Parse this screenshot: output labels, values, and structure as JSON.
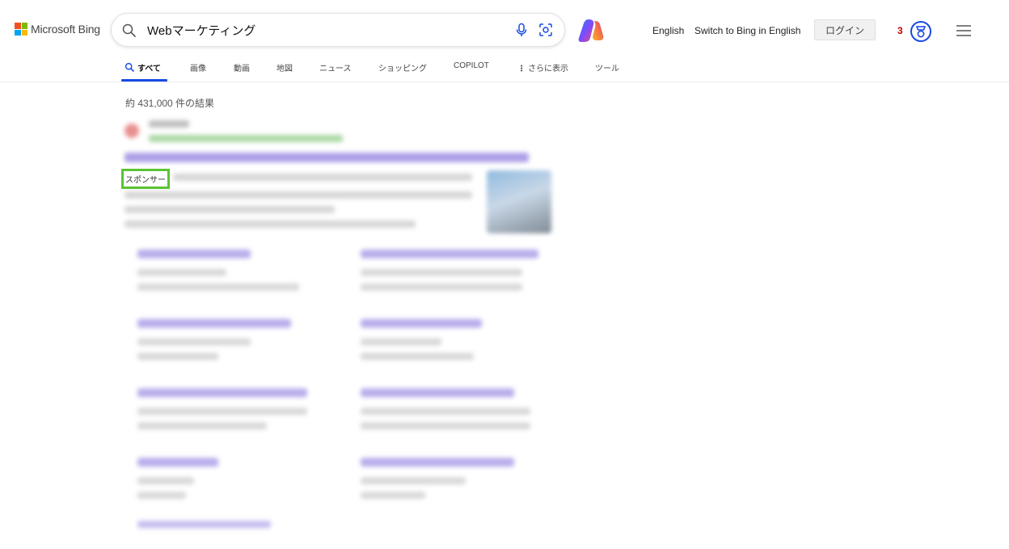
{
  "header": {
    "logo_text": "Microsoft Bing",
    "search_value": "Webマーケティング",
    "links": {
      "english": "English",
      "switch": "Switch to Bing in English"
    },
    "login_label": "ログイン",
    "reward_count": "3"
  },
  "tabs": [
    {
      "label": "すべて",
      "active": true
    },
    {
      "label": "画像"
    },
    {
      "label": "動画"
    },
    {
      "label": "地図"
    },
    {
      "label": "ニュース"
    },
    {
      "label": "ショッピング"
    },
    {
      "label": "COPILOT"
    },
    {
      "label": "さらに表示"
    },
    {
      "label": "ツール"
    }
  ],
  "results": {
    "count_text": "約 431,000 件の結果",
    "ad_label": "スポンサー"
  },
  "colors": {
    "accent": "#174ae4",
    "sponsor_highlight": "#5ac434",
    "reward": "#c80000"
  },
  "icons": [
    "search-icon",
    "mic-icon",
    "visual-search-icon",
    "copilot-icon",
    "rewards-icon",
    "menu-icon"
  ]
}
